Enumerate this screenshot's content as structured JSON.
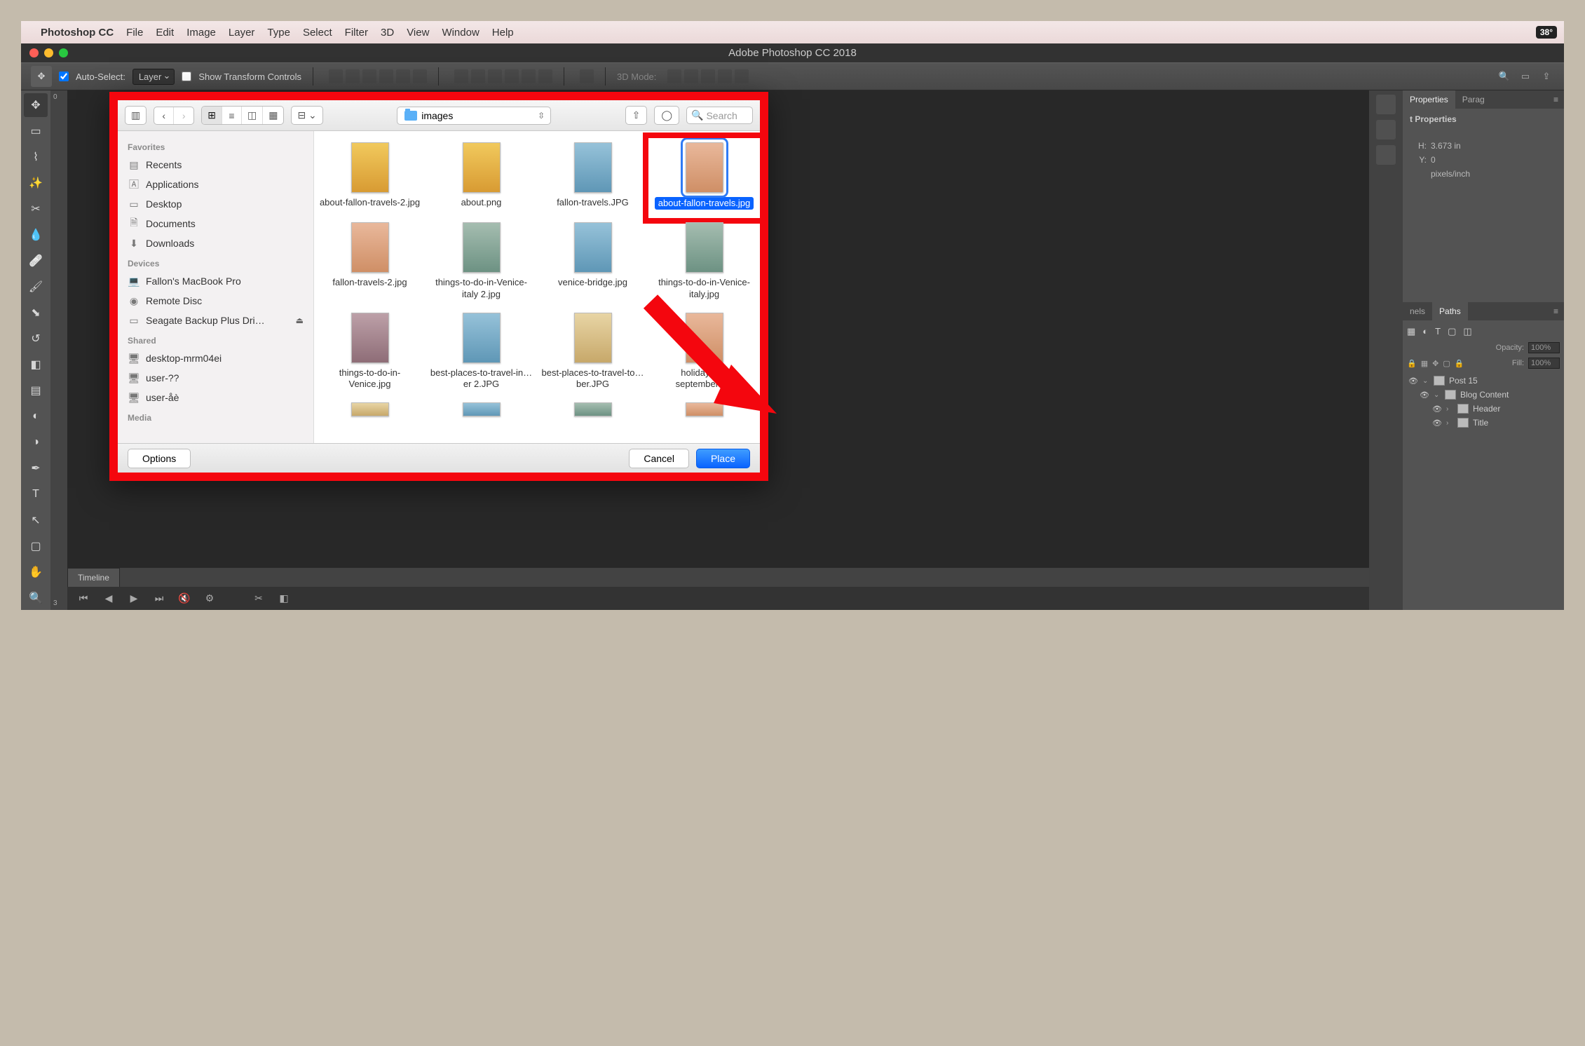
{
  "os": {
    "active_app": "Photoshop CC",
    "menus": [
      "File",
      "Edit",
      "Image",
      "Layer",
      "Type",
      "Select",
      "Filter",
      "3D",
      "View",
      "Window",
      "Help"
    ],
    "temp": "38°"
  },
  "window": {
    "title": "Adobe Photoshop CC 2018"
  },
  "options": {
    "auto_select_label": "Auto-Select:",
    "auto_select_value": "Layer",
    "show_transform_label": "Show Transform Controls",
    "mode3d_label": "3D Mode:"
  },
  "properties": {
    "tab_properties": "Properties",
    "tab_paragraph": "Parag",
    "section": "t Properties",
    "h_label": "H:",
    "h_value": "3.673 in",
    "y_label": "Y:",
    "y_value": "0",
    "res_unit": "pixels/inch"
  },
  "layers": {
    "tab_channels": "nels",
    "tab_paths": "Paths",
    "opacity_label": "Opacity:",
    "opacity_value": "100%",
    "fill_label": "Fill:",
    "fill_value": "100%",
    "tree": [
      {
        "depth": 0,
        "name": "Post 15",
        "open": true
      },
      {
        "depth": 1,
        "name": "Blog Content",
        "open": true
      },
      {
        "depth": 2,
        "name": "Header",
        "open": false
      },
      {
        "depth": 2,
        "name": "Title",
        "open": false
      }
    ]
  },
  "timeline": {
    "title": "Timeline"
  },
  "dialog": {
    "folder": "images",
    "search_placeholder": "Search",
    "sidebar": {
      "favorites_hdr": "Favorites",
      "favorites": [
        "Recents",
        "Applications",
        "Desktop",
        "Documents",
        "Downloads"
      ],
      "devices_hdr": "Devices",
      "devices": [
        "Fallon's MacBook Pro",
        "Remote Disc",
        "Seagate Backup Plus Dri…"
      ],
      "shared_hdr": "Shared",
      "shared": [
        "desktop-mrm04ei",
        "user-??",
        "user-åè"
      ],
      "media_hdr": "Media"
    },
    "files": [
      {
        "name": "about-fallon-travels-2.jpg",
        "cls": "t1"
      },
      {
        "name": "about.png",
        "cls": "t1"
      },
      {
        "name": "fallon-travels.JPG",
        "cls": "t3"
      },
      {
        "name": "about-fallon-travels.jpg",
        "cls": "t4",
        "selected": true,
        "highlight": true
      },
      {
        "name": "fallon-travels-2.jpg",
        "cls": "t4"
      },
      {
        "name": "things-to-do-in-Venice-italy 2.jpg",
        "cls": "t5"
      },
      {
        "name": "venice-bridge.jpg",
        "cls": "t3"
      },
      {
        "name": "things-to-do-in-Venice-italy.jpg",
        "cls": "t5"
      },
      {
        "name": "things-to-do-in-Venice.jpg",
        "cls": "t6"
      },
      {
        "name": "best-places-to-travel-in…er 2.JPG",
        "cls": "t3"
      },
      {
        "name": "best-places-to-travel-to…ber.JPG",
        "cls": "t2"
      },
      {
        "name": "holidays-in-september.jpg",
        "cls": "t4"
      },
      {
        "name": "",
        "cls": "t2",
        "partial": true
      },
      {
        "name": "",
        "cls": "t3",
        "partial": true
      },
      {
        "name": "",
        "cls": "t5",
        "partial": true
      },
      {
        "name": "",
        "cls": "t4",
        "partial": true
      }
    ],
    "options_btn": "Options",
    "cancel_btn": "Cancel",
    "place_btn": "Place"
  }
}
